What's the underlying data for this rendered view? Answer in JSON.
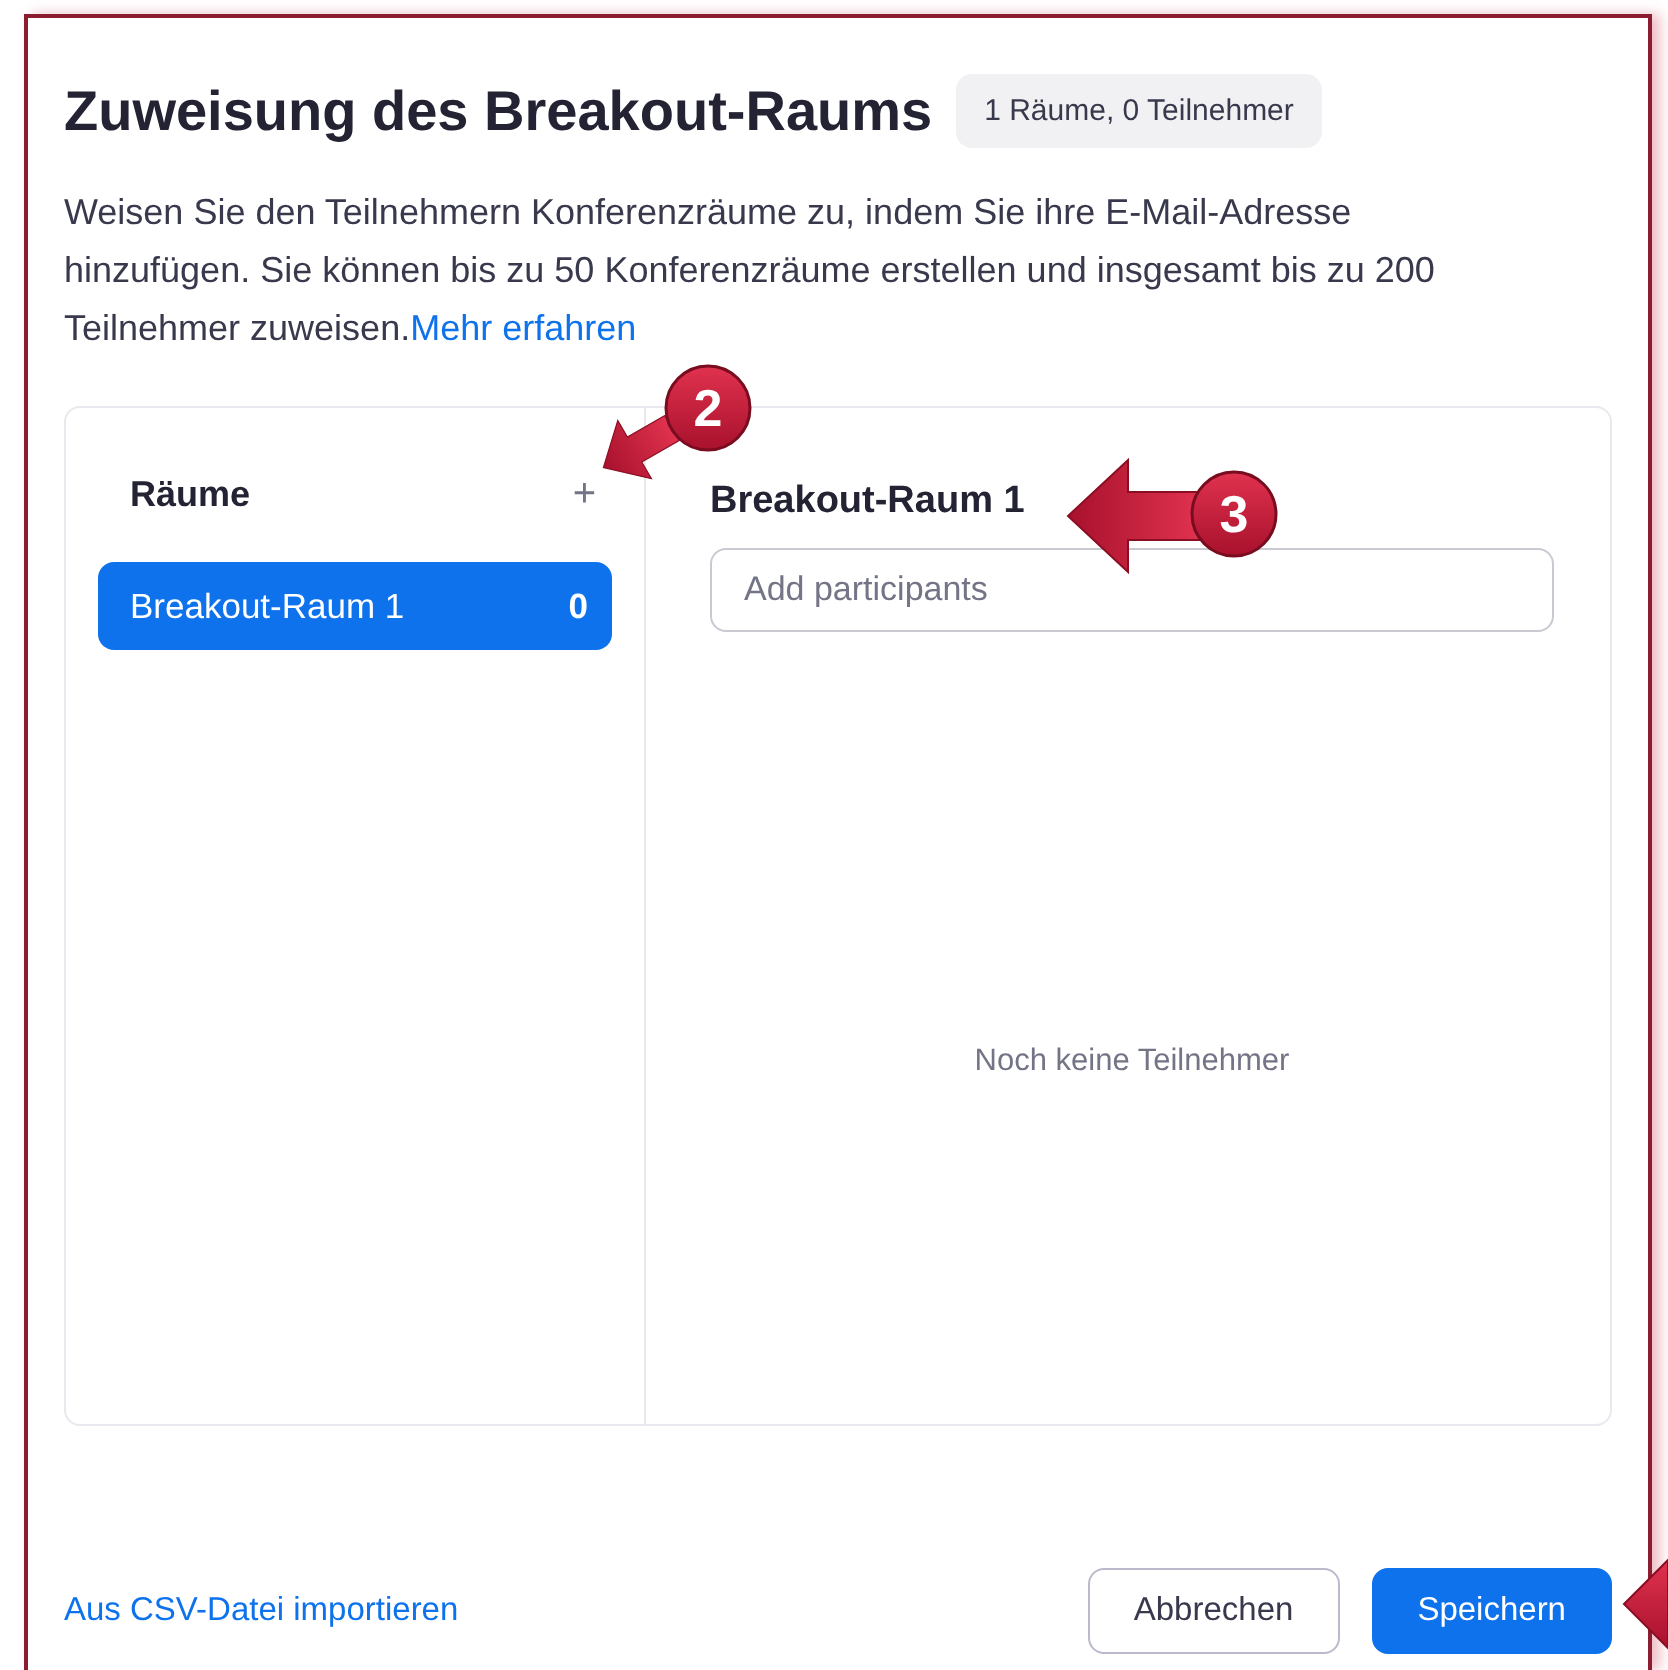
{
  "dialog": {
    "title": "Zuweisung des Breakout-Raums",
    "summary_badge": "1 Räume, 0 Teilnehmer",
    "description": "Weisen Sie den Teilnehmern Konferenzräume zu, indem Sie ihre E-Mail-Adresse hinzufügen. Sie können bis zu 50 Konferenzräume erstellen und insgesamt bis zu 200 Teilnehmer zuweisen.",
    "learn_more_link": "Mehr erfahren"
  },
  "rooms_panel": {
    "heading": "Räume",
    "add_button": "+",
    "rooms": [
      {
        "name": "Breakout-Raum 1",
        "count": "0",
        "selected": true
      }
    ]
  },
  "room_detail": {
    "title": "Breakout-Raum 1",
    "participant_input": {
      "placeholder": "Add participants"
    },
    "empty_text": "Noch keine Teilnehmer"
  },
  "footer": {
    "import_link": "Aus CSV-Datei importieren",
    "buttons": [
      {
        "label": "Abbrechen",
        "kind": "secondary"
      },
      {
        "label": "Speichern",
        "kind": "primary"
      }
    ]
  },
  "callouts": [
    {
      "number": "2"
    },
    {
      "number": "3"
    }
  ]
}
